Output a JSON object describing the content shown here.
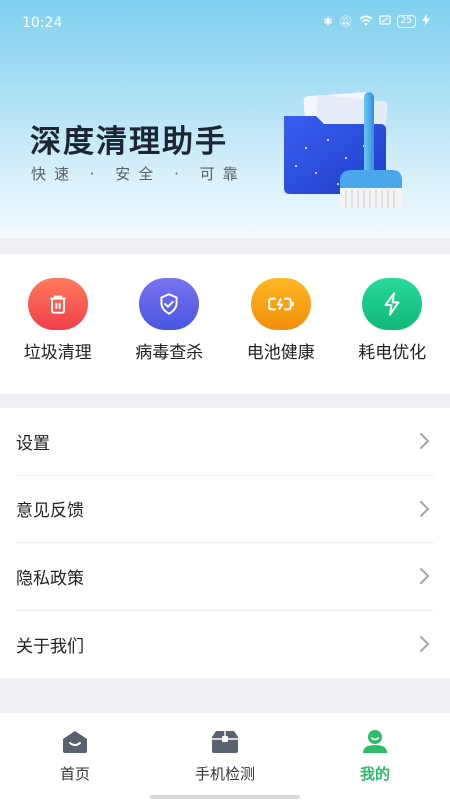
{
  "status_bar": {
    "time": "10:24",
    "battery": "25"
  },
  "header": {
    "title": "深度清理助手",
    "subtitle": "快速 · 安全 · 可靠"
  },
  "features": [
    {
      "label": "垃圾清理",
      "icon": "trash-icon",
      "color": "#f0564b"
    },
    {
      "label": "病毒查杀",
      "icon": "shield-icon",
      "color": "#5a62e6"
    },
    {
      "label": "电池健康",
      "icon": "battery-icon",
      "color": "#f7a418"
    },
    {
      "label": "耗电优化",
      "icon": "lightning-icon",
      "color": "#1fc98a"
    }
  ],
  "menu": [
    {
      "label": "设置"
    },
    {
      "label": "意见反馈"
    },
    {
      "label": "隐私政策"
    },
    {
      "label": "关于我们"
    }
  ],
  "tabs": [
    {
      "label": "首页",
      "icon": "home-icon"
    },
    {
      "label": "手机检测",
      "icon": "toolbox-icon"
    },
    {
      "label": "我的",
      "icon": "user-icon",
      "active": true
    }
  ],
  "colors": {
    "accent": "#2dbb6c",
    "banner": "#7fd0ef"
  }
}
